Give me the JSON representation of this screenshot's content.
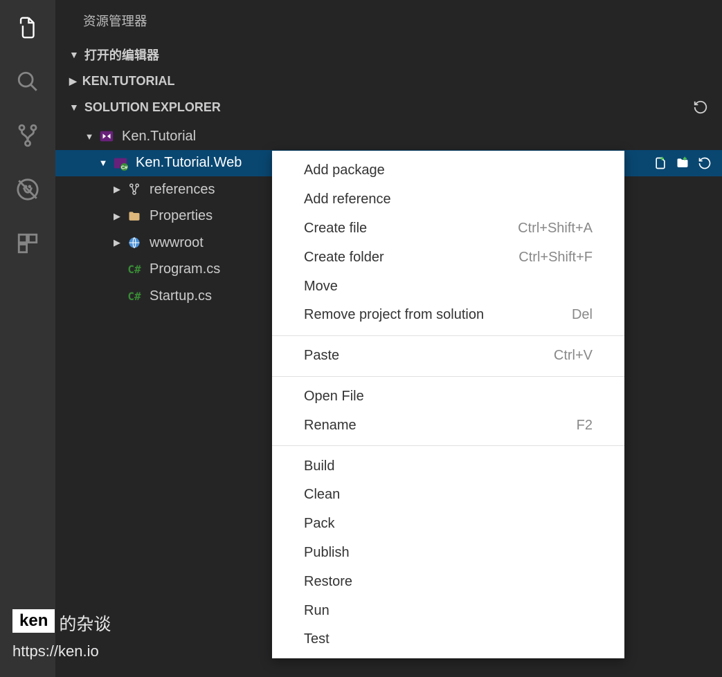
{
  "panel_title": "资源管理器",
  "sections": {
    "open_editors": "打开的编辑器",
    "project": "KEN.TUTORIAL",
    "solution_explorer": "SOLUTION EXPLORER"
  },
  "tree": {
    "solution": "Ken.Tutorial",
    "project_web": "Ken.Tutorial.Web",
    "items": {
      "references": "references",
      "properties": "Properties",
      "wwwroot": "wwwroot",
      "program": "Program.cs",
      "startup": "Startup.cs"
    }
  },
  "context_menu": {
    "groups": [
      [
        {
          "label": "Add package",
          "shortcut": ""
        },
        {
          "label": "Add reference",
          "shortcut": ""
        },
        {
          "label": "Create file",
          "shortcut": "Ctrl+Shift+A"
        },
        {
          "label": "Create folder",
          "shortcut": "Ctrl+Shift+F"
        },
        {
          "label": "Move",
          "shortcut": ""
        },
        {
          "label": "Remove project from solution",
          "shortcut": "Del"
        }
      ],
      [
        {
          "label": "Paste",
          "shortcut": "Ctrl+V"
        }
      ],
      [
        {
          "label": "Open File",
          "shortcut": ""
        },
        {
          "label": "Rename",
          "shortcut": "F2"
        }
      ],
      [
        {
          "label": "Build",
          "shortcut": ""
        },
        {
          "label": "Clean",
          "shortcut": ""
        },
        {
          "label": "Pack",
          "shortcut": ""
        },
        {
          "label": "Publish",
          "shortcut": ""
        },
        {
          "label": "Restore",
          "shortcut": ""
        },
        {
          "label": "Run",
          "shortcut": ""
        },
        {
          "label": "Test",
          "shortcut": ""
        }
      ]
    ]
  },
  "watermark": {
    "name": "ken",
    "suffix": "的杂谈",
    "url": "https://ken.io"
  },
  "csharp_label": "C#"
}
